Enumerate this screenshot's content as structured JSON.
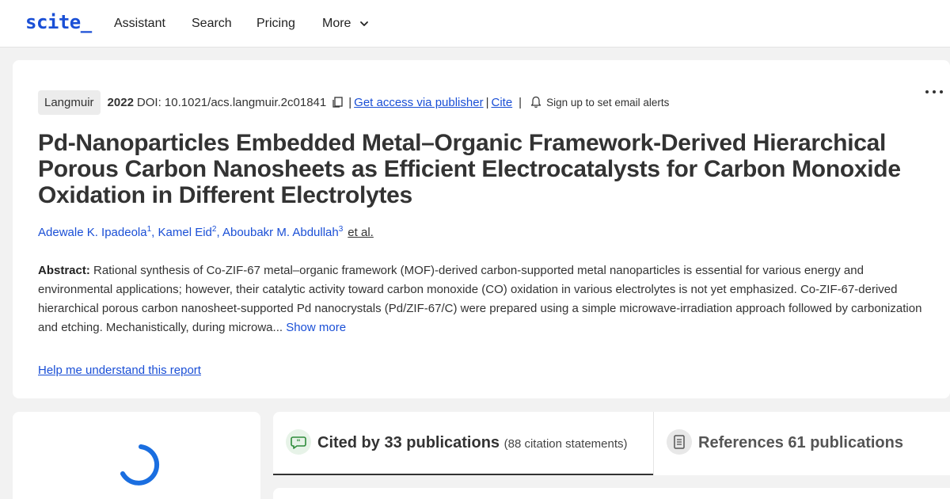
{
  "nav": {
    "logo": "scite_",
    "links": [
      "Assistant",
      "Search",
      "Pricing",
      "More"
    ]
  },
  "paper": {
    "journal": "Langmuir",
    "year": "2022",
    "doi_label": "DOI: 10.1021/acs.langmuir.2c01841",
    "access_link": "Get access via publisher",
    "cite_link": "Cite",
    "alerts_text": "Sign up to set email alerts",
    "title": "Pd-Nanoparticles Embedded Metal–Organic Framework-Derived Hierarchical Porous Carbon Nanosheets as Efficient Electrocatalysts for Carbon Monoxide Oxidation in Different Electrolytes",
    "authors": [
      {
        "name": "Adewale K. Ipadeola",
        "sup": "1"
      },
      {
        "name": "Kamel Eid",
        "sup": "2"
      },
      {
        "name": "Aboubakr M. Abdullah",
        "sup": "3"
      }
    ],
    "et_al": "et al.",
    "abstract_label": "Abstract:",
    "abstract_text": " Rational synthesis of Co-ZIF-67 metal–organic framework (MOF)-derived carbon-supported metal nanoparticles is essential for various energy and environmental applications; however, their catalytic activity toward carbon monoxide (CO) oxidation in various electrolytes is not yet emphasized. Co-ZIF-67-derived hierarchical porous carbon nanosheet-supported Pd nanocrystals (Pd/ZIF-67/C) were prepared using a simple microwave-irradiation approach followed by carbonization and etching. Mechanistically, during microwa...",
    "show_more": "Show more",
    "help_link": "Help me understand this report"
  },
  "tabs": {
    "cited_label": "Cited by 33 publications",
    "cited_sub": "(88 citation statements)",
    "refs_label": "References 61 publications"
  },
  "colors": {
    "brand": "#1a4fd6",
    "background": "#f2f2f2",
    "cited_icon_bg": "#e7f3e8",
    "cited_icon": "#2e8b3a"
  },
  "icons": [
    "chevron-down-icon",
    "copy-icon",
    "bell-icon",
    "more-options-icon",
    "loading-spinner",
    "citation-quote-icon",
    "document-icon"
  ]
}
